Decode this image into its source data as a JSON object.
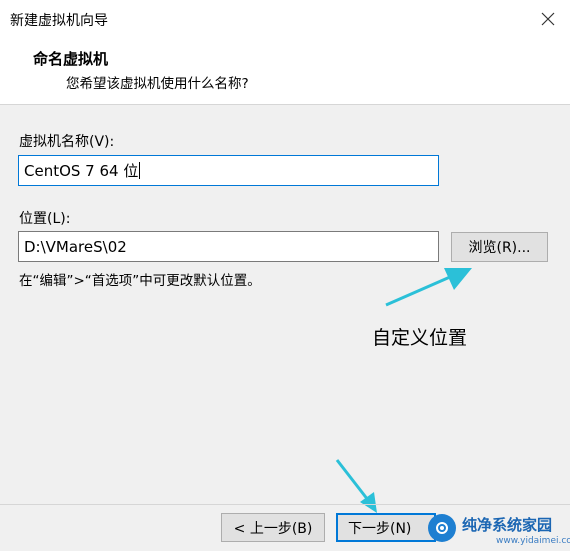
{
  "window": {
    "title": "新建虚拟机向导"
  },
  "header": {
    "title": "命名虚拟机",
    "subtitle": "您希望该虚拟机使用什么名称?"
  },
  "name_field": {
    "label": "虚拟机名称(V):",
    "value": "CentOS 7 64 位"
  },
  "location_field": {
    "label": "位置(L):",
    "value": "D:\\VMareS\\02"
  },
  "browse_button": {
    "label": "浏览(R)..."
  },
  "hint": "在“编辑”>“首选项”中可更改默认位置。",
  "annotation": {
    "text": "自定义位置",
    "arrow_color": "#2bc0d8"
  },
  "footer": {
    "back_label": "< 上一步(B)",
    "next_label": "下一步(N)"
  },
  "watermark": {
    "text": "纯净系统家园",
    "url": "www.yidaimei.com"
  },
  "colors": {
    "accent": "#0078d7",
    "arrow": "#2bc0d8"
  }
}
